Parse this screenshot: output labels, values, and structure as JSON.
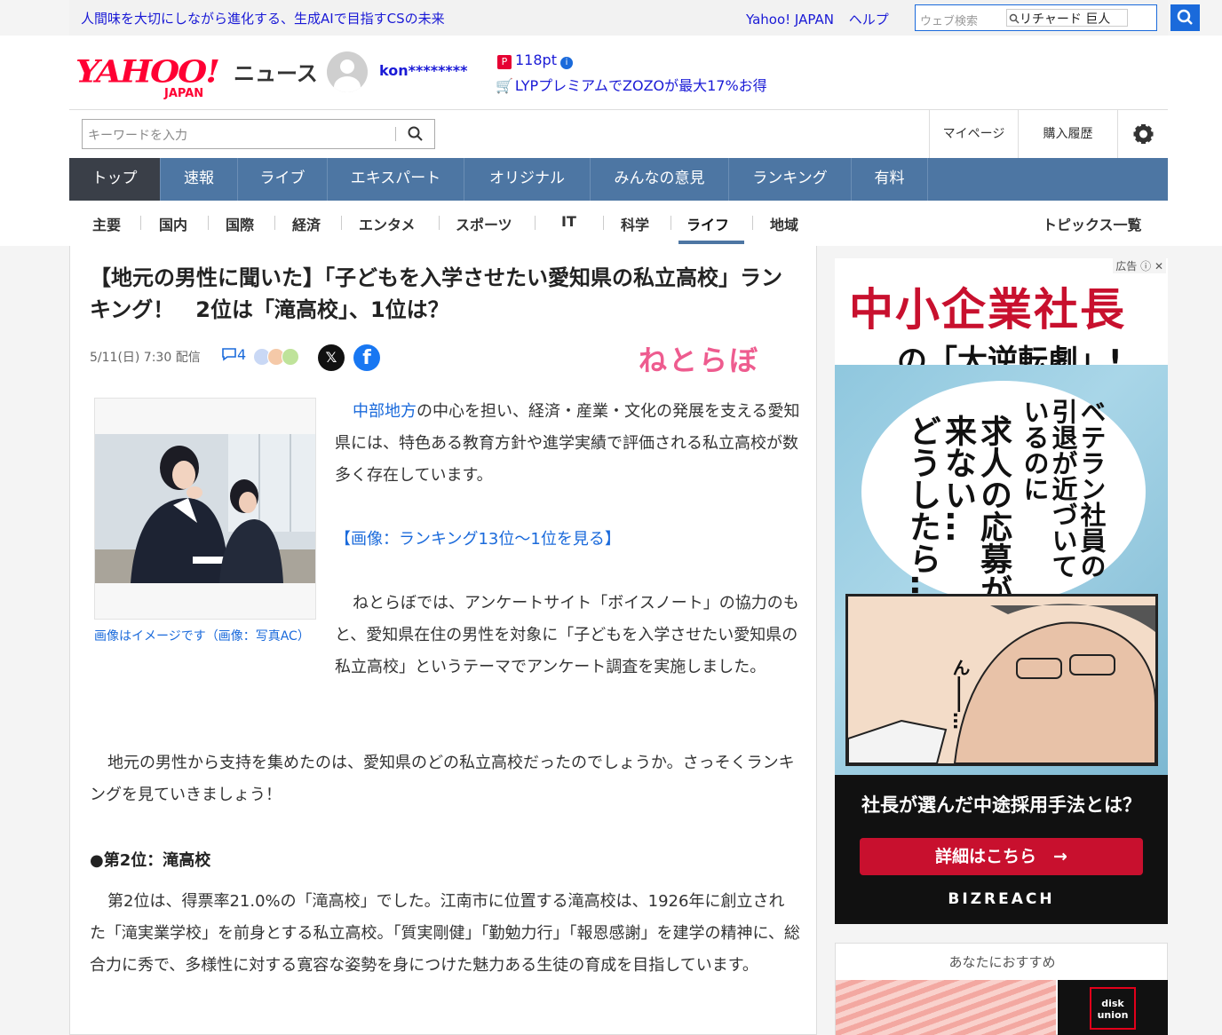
{
  "topbar": {
    "promo": "人間味を大切にしながら進化する、生成AIで目指すCSの未来",
    "links": [
      "Yahoo! JAPAN",
      "ヘルプ"
    ],
    "web_search_placeholder": "ウェブ検索",
    "web_search_suggestion": "リチャード 巨人"
  },
  "header": {
    "logo_main": "YAHOO!",
    "logo_sub": "JAPAN",
    "service": "ニュース",
    "username": "kon********",
    "points": "118pt",
    "lyp_promo": "LYPプレミアムでZOZOが最大17%お得",
    "search_placeholder": "キーワードを入力",
    "mypage": "マイページ",
    "history": "購入履歴"
  },
  "main_nav": [
    "トップ",
    "速報",
    "ライブ",
    "エキスパート",
    "オリジナル",
    "みんなの意見",
    "ランキング",
    "有料"
  ],
  "category_nav": {
    "items": [
      "主要",
      "国内",
      "国際",
      "経済",
      "エンタメ",
      "スポーツ",
      "IT",
      "科学",
      "ライフ",
      "地域"
    ],
    "active": "ライフ",
    "topics": "トピックス一覧"
  },
  "article": {
    "title": "【地元の男性に聞いた】「子どもを入学させたい愛知県の私立高校」ランキング！　2位は「滝高校」、1位は？",
    "date": "5/11(日) 7:30 配信",
    "comment_count": "4",
    "publisher": "ねとらぼ",
    "image_caption": "画像はイメージです（画像：写真AC）",
    "p1_link": "中部地方",
    "p1_rest": "の中心を担い、経済・産業・文化の発展を支える愛知県には、特色ある教育方針や進学実績で評価される私立高校が数多く存在しています。",
    "p2_link": "【画像：ランキング13位～1位を見る】",
    "p3": "ねとらぼでは、アンケートサイト「ボイスノート」の協力のもと、愛知県在住の男性を対象に「子どもを入学させたい愛知県の私立高校」というテーマでアンケート調査を実施しました。",
    "p4": "地元の男性から支持を集めたのは、愛知県のどの私立高校だったのでしょうか。さっそくランキングを見ていきましょう！",
    "h2": "●第2位：滝高校",
    "p5": "第2位は、得票率21.0%の「滝高校」でした。江南市に位置する滝高校は、1926年に創立された「滝実業学校」を前身とする私立高校。「質実剛健」「勤勉力行」「報恩感謝」を建学の精神に、総合力に秀で、多様性に対する寛容な姿勢を身につけた魅力ある生徒の育成を目指しています。"
  },
  "ad": {
    "tag": "広告",
    "headline1": "中小企業社長",
    "headline2": "の「大逆転劇」!",
    "bubble_col1": "ベテラン社員の",
    "bubble_col2": "引退が近づいて",
    "bubble_col3": "いるのに",
    "bubble_col4": "求人の応募が",
    "bubble_col5": "来ない…",
    "bubble_col6": "どうしたら…",
    "manga_sfx": "ん――…",
    "question": "社長が選んだ中途採用手法とは？",
    "cta": "詳細はこちら　→",
    "brand": "BIZREACH"
  },
  "recommend": {
    "title": "あなたにおすすめ",
    "item2_label": "disk union"
  },
  "colors": {
    "nav_blue": "#4d76a3",
    "nav_active": "#3a3f48",
    "link_blue": "#1a6adb",
    "yahoo_red": "#ff0033",
    "ad_red": "#c8102e",
    "publisher_pink": "#ee5c8f"
  }
}
